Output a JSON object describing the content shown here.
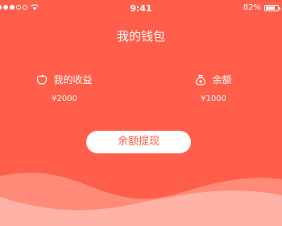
{
  "status_bar": {
    "time": "9:41",
    "battery_percent": "82%",
    "battery_level": 0.82
  },
  "header": {
    "title": "我的钱包"
  },
  "stats": {
    "earnings": {
      "label": "我的收益",
      "value": "¥2000",
      "icon": "apple-icon"
    },
    "balance": {
      "label": "余额",
      "value": "¥1000",
      "icon": "money-bag-icon"
    }
  },
  "actions": {
    "withdraw_label": "余额提现"
  },
  "colors": {
    "background": "#FF5E4A",
    "wave_light": "#FF8A78",
    "wave_lighter": "#FFB2A6",
    "button_bg": "#ffffff",
    "button_text": "#FF5E4A"
  }
}
